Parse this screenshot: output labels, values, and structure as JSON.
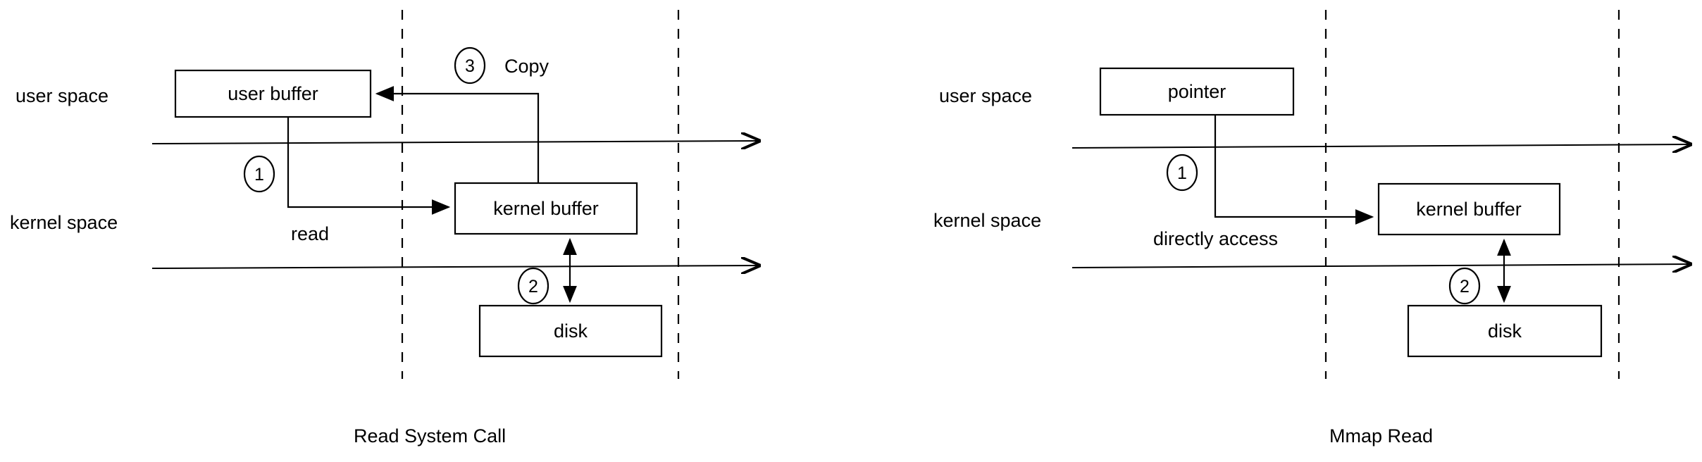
{
  "diagram": {
    "panels": [
      {
        "id": "read-system-call",
        "caption": "Read System Call",
        "space_labels": {
          "user": "user space",
          "kernel": "kernel space"
        },
        "boxes": [
          {
            "id": "user-buffer",
            "label": "user buffer"
          },
          {
            "id": "kernel-buffer",
            "label": "kernel buffer"
          },
          {
            "id": "disk",
            "label": "disk"
          }
        ],
        "steps": [
          {
            "number": "1",
            "label": "read"
          },
          {
            "number": "2",
            "label": ""
          },
          {
            "number": "3",
            "label": "Copy"
          }
        ]
      },
      {
        "id": "mmap-read",
        "caption": "Mmap Read",
        "space_labels": {
          "user": "user space",
          "kernel": "kernel space"
        },
        "boxes": [
          {
            "id": "pointer",
            "label": "pointer"
          },
          {
            "id": "kernel-buffer",
            "label": "kernel buffer"
          },
          {
            "id": "disk",
            "label": "disk"
          }
        ],
        "steps": [
          {
            "number": "1",
            "label": "directly access"
          },
          {
            "number": "2",
            "label": ""
          }
        ]
      }
    ],
    "colors": {
      "stroke": "#000000",
      "background": "#ffffff",
      "text": "#000000"
    }
  }
}
